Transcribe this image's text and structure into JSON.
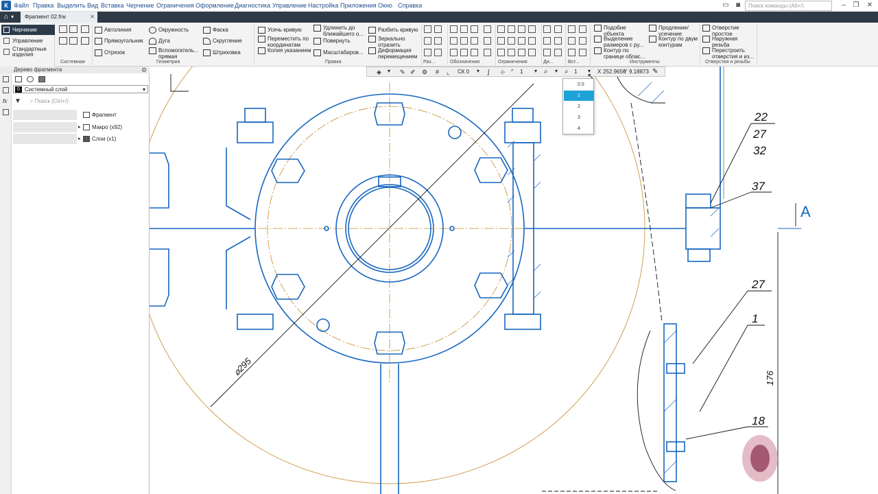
{
  "menu": [
    "Файл",
    "Правка",
    "Выделить",
    "Вид",
    "Вставка",
    "Черчение",
    "Ограничения",
    "Оформление",
    "Диагностика",
    "Управление",
    "Настройка",
    "Приложения",
    "Окно",
    "Справка"
  ],
  "command_search": {
    "placeholder": "Поиск команды (Alt+/)"
  },
  "document_tab": {
    "title": "Фрагмент 02.frw"
  },
  "ribbon": {
    "side_items": [
      "Черчение",
      "Управление",
      "Стандартные изделия"
    ],
    "group_labels": {
      "system": "Системная",
      "geometry": "Геометрия",
      "edit": "Правка",
      "marks": "Обозначения",
      "constraints": "Ограничения",
      "tools": "Инструменты",
      "holes": "Отверстия и резьбы",
      "abbr_raz": "Раз...",
      "abbr_di": "Ди...",
      "abbr_vst": "Вст..."
    },
    "geometry": [
      "Автолиния",
      "Окружность",
      "Фаска",
      "Прямоугольник",
      "Дуга",
      "Скругление",
      "Отрезок",
      "Вспомогатель... прямая",
      "Штриховка"
    ],
    "edit": [
      "Усечь кривую",
      "Удлинить до ближайшего о...",
      "Разбить кривую",
      "Переместить по координатам",
      "Повернуть",
      "Зеркально отразить",
      "Копия указанием",
      "Масштабиров...",
      "Деформация перемещением"
    ],
    "tools": [
      "Подобие объекта",
      "Продление/ усечение",
      "Выделение размеров с ру...",
      "Контур по двум контурам",
      "Контур по границе облас..."
    ],
    "holes": [
      "Отверстие простое",
      "Наружная резьба",
      "Перестроить отверстия и из..."
    ]
  },
  "panel": {
    "title": "Дерево фрагмента",
    "layer_number": "0",
    "layer": "Системный слой",
    "search_placeholder": "Поиск (Ctrl+/)",
    "tree": [
      "Фрагмент",
      "Макро (x92)",
      "Слои (x1)"
    ]
  },
  "canvas_toolbar": {
    "scale": "1",
    "cs": "СК 0",
    "style": "1",
    "zoom": "1",
    "coord_x_label": "X",
    "coord_x": "252.9656",
    "coord_y_label": "Y",
    "coord_y": "9.18873"
  },
  "zoom_dropdown": {
    "options": [
      "0.5",
      "1",
      "2",
      "3",
      "4"
    ],
    "selected": "1"
  },
  "drawing": {
    "labels": [
      "22",
      "27",
      "32",
      "37",
      "27",
      "1",
      "18"
    ],
    "diameter": "⌀295",
    "dimension": "176",
    "section": "А"
  },
  "colors": {
    "line": "#1565c0",
    "axis": "#c58a2a",
    "ribbon_active": "#2b3a4b",
    "selected": "#1ea3d8"
  }
}
